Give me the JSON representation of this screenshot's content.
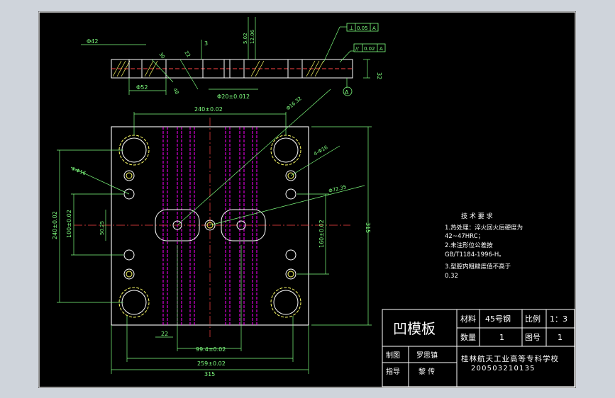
{
  "title_block": {
    "part_name": "凹模板",
    "material_label": "材料",
    "material_value": "45号钢",
    "scale_label": "比例",
    "scale_value": "1：3",
    "qty_label": "数量",
    "qty_value": "1",
    "drawing_no_label": "图号",
    "drawing_no_value": "1",
    "drawn_label": "制图",
    "drawn_name": "罗思镇",
    "guide_label": "指导",
    "guide_name": "黎  传",
    "school": "桂林航天工业高等专科学校",
    "student_id": "200503210135"
  },
  "tech_req": {
    "title": "技 术 要 求",
    "lines": [
      "1.热处理：淬火回火后硬度为",
      "42~47HRC；",
      "2.未注形位公差按",
      "GB/T1184-1996-H。",
      "3.型腔内粗糙度值不高于",
      "0.32"
    ]
  },
  "dims": {
    "d_240x": "240±0.02",
    "d_259x": "259±0.02",
    "d_99x": "99.4±0.02",
    "d_22": "22",
    "d_315b": "315",
    "d_315r": "315",
    "d_240y": "240±0.02",
    "d_100y": "100±0.02",
    "d_50y": "50.25",
    "d_160y": "160±0.02",
    "d_4phi16": "4-Φ16",
    "d_4phi16t": "4-Φ16",
    "d_phi72": "Φ72.35",
    "d_phi16b": "Φ16.32",
    "d_phi20": "Φ20±0.012",
    "d_phi52": "Φ52",
    "d_phi42": "Φ42",
    "d_32": "32",
    "d_3": "3",
    "d_50b": "5.02",
    "d_12": "12.06",
    "d_48": "48",
    "d_30": "30",
    "d_22b": "22",
    "tol1_sym": "⊥",
    "tol1_val": "0.05",
    "tol1_ref": "A",
    "tol2_sym": "//",
    "tol2_val": "0.02",
    "tol2_ref": "A",
    "datum": "A"
  },
  "colors": {
    "background": "#000000",
    "frame": "#ffffff",
    "hidden": "#ff00ff",
    "dimension": "#7fff7f",
    "text_yellow": "#ffff66"
  }
}
